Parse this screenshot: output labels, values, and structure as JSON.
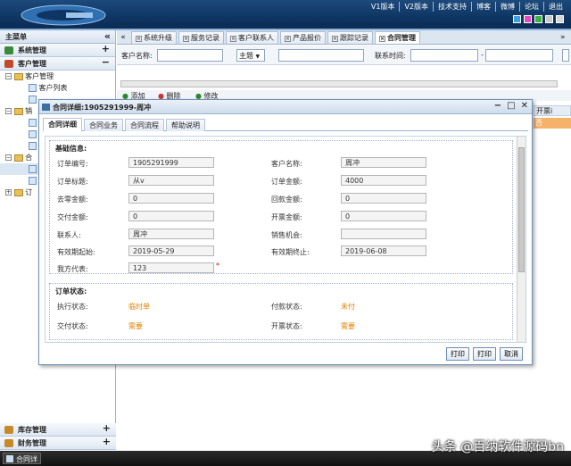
{
  "header": {
    "links": [
      "V1版本",
      "V2版本",
      "技术支持",
      "博客",
      "微博",
      "论坛",
      "退出"
    ],
    "swatch_colors": [
      "#3c9fe0",
      "#e24db8",
      "#3bb33b",
      "#c9c9c9",
      "#d6d6d6"
    ]
  },
  "sidebar": {
    "title": "主菜单",
    "collapse_glyph": "«",
    "sections_top": [
      {
        "label": "系统管理",
        "toggle": "+"
      },
      {
        "label": "客户管理",
        "toggle": "−"
      }
    ],
    "tree": {
      "customer_folder": "客户管理",
      "customer_list": "客户列表",
      "sales_folder": "销",
      "contract_folder": "合",
      "order_folder": "订"
    },
    "sections_bottom": [
      {
        "label": "库存管理",
        "toggle": "+"
      },
      {
        "label": "财务管理",
        "toggle": "+"
      }
    ]
  },
  "tabs": [
    "系统升级",
    "服务记录",
    "客户联系人",
    "产品报价",
    "跟踪记录",
    "合同管理"
  ],
  "search": {
    "customer_name_label": "客户名称:",
    "topic_label": "主题",
    "contact_time_label": "联系时间:",
    "separator": "-"
  },
  "toolbar": {
    "add": "添加",
    "delete": "删除",
    "edit": "修改"
  },
  "grid_right": {
    "header": "开票i",
    "cell": "否"
  },
  "dialog": {
    "title": "合同详细:1905291999-周冲",
    "tabs": [
      "合同详细",
      "合同业务",
      "合同流程",
      "帮助说明"
    ],
    "basic_legend": "基础信息:",
    "fields": {
      "order_no_label": "订单编号:",
      "order_no": "1905291999",
      "customer_label": "客户名称:",
      "customer": "周冲",
      "order_title_label": "订单标题:",
      "order_title": "从v",
      "order_amount_label": "订单金额:",
      "order_amount": "4000",
      "zero_amount_label": "去零金额:",
      "zero_amount": "0",
      "return_amount_label": "回款金额:",
      "return_amount": "0",
      "deliver_amount_label": "交付金额:",
      "deliver_amount": "0",
      "invoice_amount_label": "开票金额:",
      "invoice_amount": "0",
      "contact_label": "联系人:",
      "contact": "周冲",
      "opportunity_label": "销售机会:",
      "opportunity": "",
      "valid_start_label": "有效期起始:",
      "valid_start": "2019-05-29",
      "valid_end_label": "有效期终止:",
      "valid_end": "2019-06-08",
      "our_rep_label": "我方代表:",
      "our_rep": "123",
      "required_mark": "*"
    },
    "status_legend": "订单状态:",
    "status": {
      "exec_label": "执行状态:",
      "exec": "临时单",
      "pay_label": "付款状态:",
      "pay": "未付",
      "deliver_label": "交付状态:",
      "deliver": "需要",
      "invoice_label": "开票状态:",
      "invoice": "需要"
    },
    "buttons": [
      "打印",
      "打印",
      "取消"
    ]
  },
  "taskbar": {
    "item": "合同详"
  },
  "watermark": "头条 @百纳软件源码bn"
}
